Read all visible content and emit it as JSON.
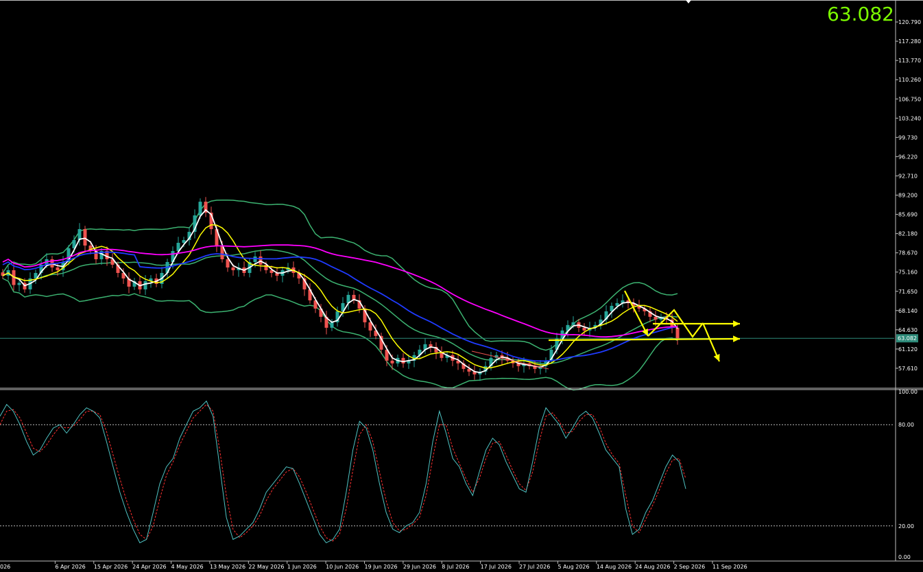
{
  "current_price": "63.082",
  "current_price_value": 63.082,
  "colors": {
    "background": "#000000",
    "candle_up": "#26a69a",
    "candle_down": "#ef5350",
    "bollinger": "#3cb371",
    "ma_fast_white": "#ffffff",
    "ma_yellow": "#ffff00",
    "ma_blue": "#1f3bff",
    "ma_magenta": "#ff00ff",
    "stoch_main": "#4fc3c3",
    "stoch_signal": "#ff3030",
    "price_line": "#2e8b7a",
    "arrows": "#ffff00",
    "big_price": "#7CFC00"
  },
  "price_axis": {
    "labels": [
      "120.790",
      "117.280",
      "113.770",
      "110.260",
      "106.750",
      "103.240",
      "99.730",
      "96.220",
      "92.710",
      "89.200",
      "85.690",
      "82.180",
      "78.670",
      "75.160",
      "71.650",
      "68.140",
      "64.630",
      "61.120",
      "57.610"
    ],
    "min": 54.1,
    "max": 124.3
  },
  "oscillator_axis": {
    "labels": [
      "100.00",
      "80.00",
      "20.00",
      "0.00"
    ],
    "levels": [
      100,
      80,
      20,
      0
    ]
  },
  "time_axis": {
    "labels": [
      "026",
      "6 Apr 2026",
      "15 Apr 2026",
      "24 Apr 2026",
      "4 May 2026",
      "13 May 2026",
      "22 May 2026",
      "1 Jun 2026",
      "10 Jun 2026",
      "19 Jun 2026",
      "29 Jun 2026",
      "8 Jul 2026",
      "17 Jul 2026",
      "27 Jul 2026",
      "5 Aug 2026",
      "14 Aug 2026",
      "24 Aug 2026",
      "2 Sep 2026",
      "11 Sep 2026"
    ]
  },
  "chart_data": {
    "type": "candlestick",
    "symbol_price": 63.082,
    "closes": [
      74.5,
      75.5,
      72.8,
      73.2,
      72.0,
      74.0,
      75.0,
      76.5,
      77.5,
      76.0,
      75.5,
      77.0,
      79.5,
      81.0,
      83.0,
      80.0,
      79.0,
      77.5,
      79.0,
      77.5,
      76.5,
      75.0,
      74.0,
      72.5,
      73.5,
      72.0,
      73.5,
      74.0,
      73.0,
      75.0,
      77.0,
      79.0,
      80.5,
      81.0,
      82.5,
      85.5,
      88.0,
      86.0,
      83.0,
      80.0,
      77.5,
      76.0,
      75.5,
      76.0,
      75.0,
      77.0,
      78.0,
      76.5,
      75.5,
      75.0,
      74.5,
      75.5,
      76.0,
      75.0,
      74.0,
      72.0,
      70.0,
      68.5,
      67.0,
      65.0,
      66.0,
      68.0,
      69.5,
      71.0,
      70.0,
      68.5,
      66.0,
      64.5,
      63.5,
      61.0,
      59.0,
      58.5,
      59.5,
      58.5,
      59.0,
      60.0,
      61.0,
      62.0,
      61.5,
      60.5,
      59.5,
      60.0,
      59.0,
      58.5,
      57.5,
      57.0,
      56.5,
      57.0,
      58.0,
      59.5,
      60.0,
      59.5,
      59.0,
      58.5,
      58.0,
      58.5,
      58.0,
      57.5,
      58.0,
      59.0,
      61.0,
      63.0,
      64.5,
      65.5,
      66.0,
      65.0,
      64.5,
      65.0,
      65.5,
      66.5,
      68.0,
      69.0,
      69.5,
      70.0,
      69.5,
      69.0,
      68.5,
      68.0,
      67.0,
      66.5,
      67.0,
      66.5,
      65.0,
      63.1
    ],
    "oscillator_main": [
      85,
      92,
      88,
      80,
      70,
      62,
      65,
      72,
      78,
      80,
      75,
      80,
      86,
      90,
      88,
      84,
      70,
      55,
      40,
      28,
      18,
      10,
      12,
      28,
      45,
      55,
      60,
      72,
      80,
      88,
      90,
      94,
      85,
      55,
      25,
      12,
      14,
      18,
      22,
      30,
      40,
      45,
      50,
      55,
      54,
      45,
      35,
      25,
      15,
      10,
      12,
      18,
      40,
      65,
      82,
      78,
      65,
      45,
      28,
      18,
      16,
      20,
      22,
      28,
      45,
      70,
      88,
      75,
      60,
      55,
      45,
      38,
      52,
      65,
      72,
      68,
      58,
      50,
      42,
      40,
      58,
      78,
      90,
      85,
      80,
      72,
      78,
      85,
      88,
      84,
      75,
      65,
      60,
      55,
      30,
      15,
      18,
      28,
      35,
      45,
      55,
      62,
      58,
      42
    ],
    "oscillator_signal": [
      80,
      88,
      89,
      84,
      75,
      66,
      64,
      68,
      74,
      79,
      78,
      79,
      83,
      88,
      88,
      86,
      76,
      62,
      48,
      35,
      24,
      15,
      12,
      20,
      36,
      50,
      58,
      68,
      76,
      84,
      88,
      92,
      88,
      65,
      38,
      18,
      13,
      16,
      20,
      26,
      35,
      42,
      47,
      52,
      54,
      49,
      40,
      30,
      20,
      13,
      11,
      15,
      30,
      53,
      74,
      80,
      70,
      52,
      35,
      22,
      17,
      18,
      21,
      25,
      38,
      60,
      80,
      80,
      66,
      57,
      48,
      40,
      48,
      60,
      69,
      70,
      62,
      53,
      45,
      41,
      52,
      70,
      85,
      87,
      82,
      75,
      76,
      82,
      86,
      86,
      79,
      69,
      62,
      57,
      38,
      20,
      16,
      24,
      32,
      41,
      51,
      59,
      60,
      48
    ],
    "levels": {
      "overbought": 80,
      "oversold": 20
    }
  }
}
